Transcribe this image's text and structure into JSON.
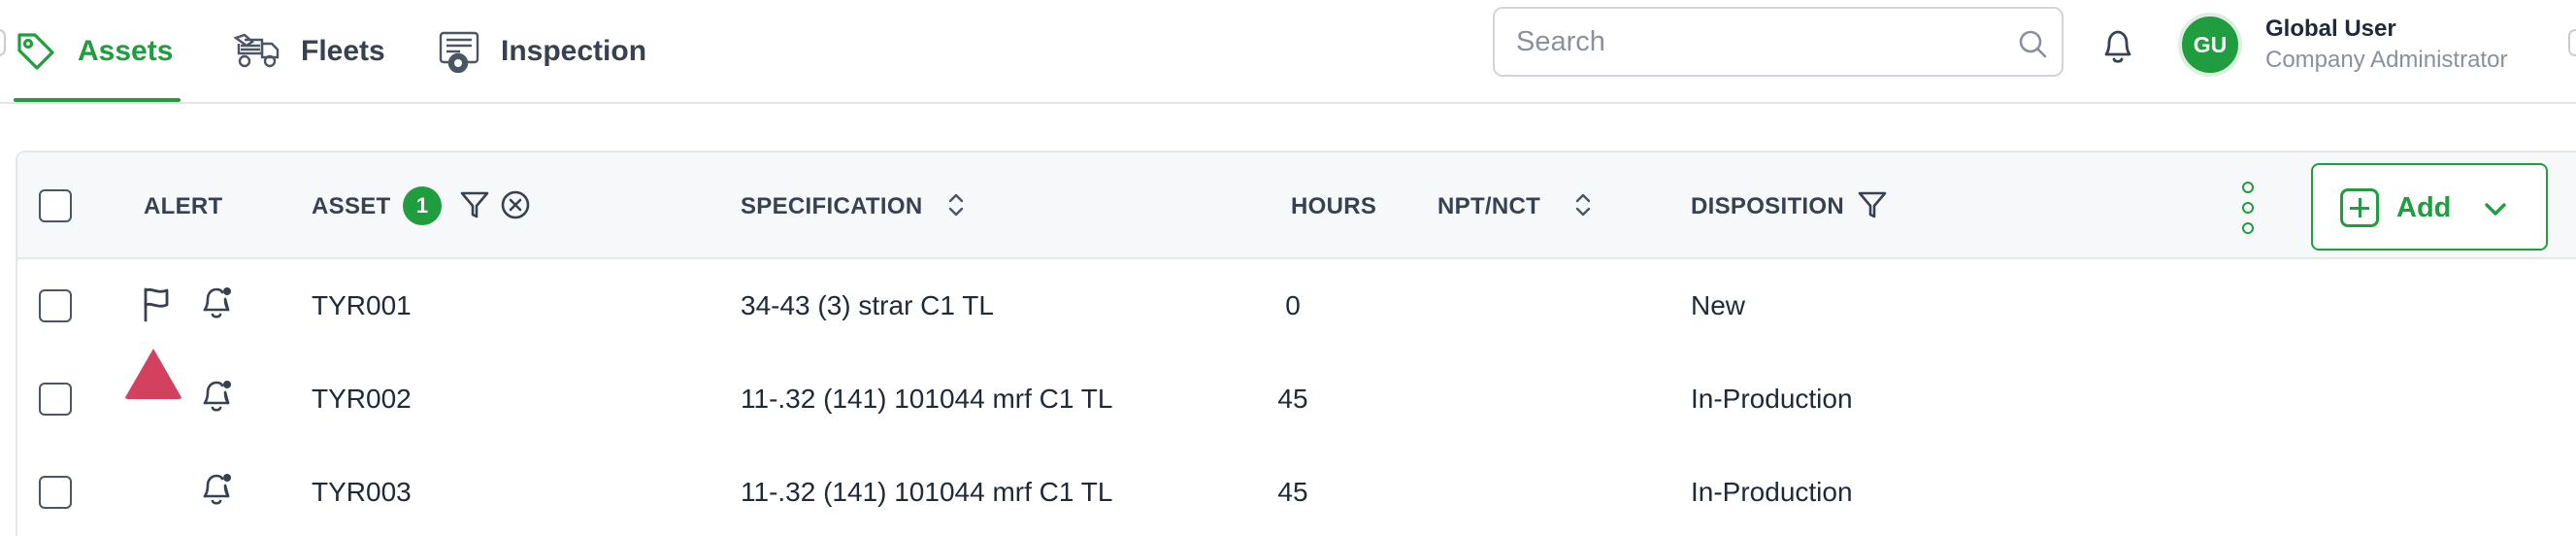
{
  "nav": {
    "tabs": [
      {
        "label": "Assets",
        "icon": "tag-icon",
        "active": true
      },
      {
        "label": "Fleets",
        "icon": "truck-icon",
        "active": false
      },
      {
        "label": "Inspection",
        "icon": "inspection-icon",
        "active": false
      }
    ],
    "search": {
      "placeholder": "Search",
      "value": ""
    },
    "notifications_icon": "bell-icon",
    "user": {
      "initials": "GU",
      "name": "Global User",
      "role": "Company Administrator"
    }
  },
  "table": {
    "columns": {
      "alert": "ALERT",
      "asset": "ASSET",
      "asset_filter_count": "1",
      "specification": "SPECIFICATION",
      "hours": "HOURS",
      "npt_nct": "NPT/NCT",
      "disposition": "DISPOSITION"
    },
    "add_button": {
      "label": "Add"
    },
    "rows": [
      {
        "asset": "TYR001",
        "specification": "34-43 (3) strar C1 TL",
        "hours": "0",
        "npt_nct": "",
        "disposition": "New",
        "alerts": [
          "flag-icon",
          "bell-alert-icon"
        ]
      },
      {
        "asset": "TYR002",
        "specification": "11-.32 (141) 101044 mrf C1 TL",
        "hours": "45",
        "npt_nct": "",
        "disposition": "In-Production",
        "alerts": [
          "warning-triangle-icon",
          "bell-alert-icon"
        ]
      },
      {
        "asset": "TYR003",
        "specification": "11-.32 (141) 101044 mrf C1 TL",
        "hours": "45",
        "npt_nct": "",
        "disposition": "In-Production",
        "alerts": [
          "bell-alert-icon"
        ]
      }
    ]
  },
  "colors": {
    "accent": "#1f9d3f",
    "alert": "#d4405f",
    "text": "#1f2937",
    "muted": "#8a919c"
  }
}
